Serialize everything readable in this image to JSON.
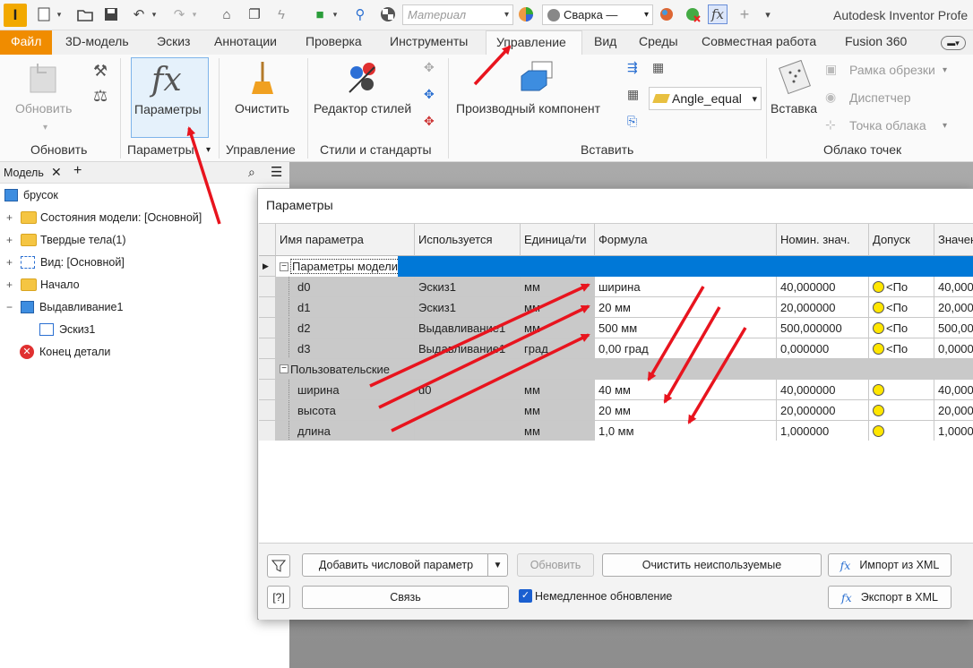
{
  "app_title": "Autodesk Inventor Profe",
  "qat": {
    "material_placeholder": "Материал",
    "appearance": "Сварка —"
  },
  "tabs": [
    "Файл",
    "3D-модель",
    "Эскиз",
    "Аннотации",
    "Проверка",
    "Инструменты",
    "Управление",
    "Вид",
    "Среды",
    "Совместная работа",
    "Fusion 360"
  ],
  "active_tab": "Управление",
  "ribbon": {
    "update_btn": "Обновить",
    "params_btn": "Параметры",
    "purge_btn": "Очистить",
    "style_editor": "Редактор стилей",
    "derive_btn": "Производный компонент",
    "angle_combo": "Angle_equal",
    "insert_btn": "Вставка",
    "crop_box": "Рамка обрезки",
    "manager": "Диспетчер",
    "cloud_point": "Точка облака",
    "panels": {
      "update": "Обновить",
      "params": "Параметры",
      "manage": "Управление",
      "styles": "Стили и стандарты",
      "insert": "Вставить",
      "pointcloud": "Облако точек"
    }
  },
  "browser": {
    "tab_label": "Модель",
    "items": [
      {
        "label": "брусок"
      },
      {
        "label": "Состояния модели: [Основной]"
      },
      {
        "label": "Твердые тела(1)"
      },
      {
        "label": "Вид: [Основной]"
      },
      {
        "label": "Начало"
      },
      {
        "label": "Выдавливание1"
      },
      {
        "label": "Эскиз1"
      },
      {
        "label": "Конец детали"
      }
    ]
  },
  "dialog": {
    "title": "Параметры",
    "columns": [
      "Имя параметра",
      "Используется",
      "Единица/ти",
      "Формула",
      "Номин. знач.",
      "Допуск",
      "Значен"
    ],
    "group_model": "Параметры модели",
    "group_user": "Пользовательские",
    "model_rows": [
      {
        "name": "d0",
        "used": "Эскиз1",
        "unit": "мм",
        "formula": "ширина",
        "nominal": "40,000000",
        "tol": "<По",
        "value": "40,000"
      },
      {
        "name": "d1",
        "used": "Эскиз1",
        "unit": "мм",
        "formula": "20 мм",
        "nominal": "20,000000",
        "tol": "<По",
        "value": "20,000"
      },
      {
        "name": "d2",
        "used": "Выдавливание1",
        "unit": "мм",
        "formula": "500 мм",
        "nominal": "500,000000",
        "tol": "<По",
        "value": "500,00"
      },
      {
        "name": "d3",
        "used": "Выдавливание1",
        "unit": "град",
        "formula": "0,00 град",
        "nominal": "0,000000",
        "tol": "<По",
        "value": "0,0000"
      }
    ],
    "user_rows": [
      {
        "name": "ширина",
        "used": "d0",
        "unit": "мм",
        "formula": "40 мм",
        "nominal": "40,000000",
        "tol": "",
        "value": "40,000"
      },
      {
        "name": "высота",
        "used": "",
        "unit": "мм",
        "formula": "20 мм",
        "nominal": "20,000000",
        "tol": "",
        "value": "20,000"
      },
      {
        "name": "длина",
        "used": "",
        "unit": "мм",
        "formula": "1,0 мм",
        "nominal": "1,000000",
        "tol": "",
        "value": "1,0000"
      }
    ],
    "buttons": {
      "add_numeric": "Добавить числовой параметр",
      "update": "Обновить",
      "purge_unused": "Очистить неиспользуемые",
      "import_xml": "Импорт из XML",
      "link": "Связь",
      "immediate_update": "Немедленное обновление",
      "export_xml": "Экспорт в XML"
    },
    "immediate_update_checked": true
  },
  "colors": {
    "accent_orange": "#f08c00",
    "selection_blue": "#0078d7",
    "annotation_red": "#e8141e"
  }
}
